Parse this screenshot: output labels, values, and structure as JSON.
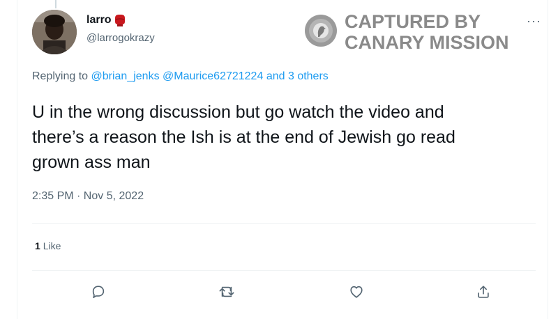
{
  "tweet": {
    "display_name": "larro",
    "handle": "@larrogokrazy",
    "replying_prefix": "Replying to",
    "replying_users": "@brian_jenks @Maurice62721224",
    "replying_connector": "and",
    "replying_others": "3 others",
    "text_lines": [
      "U in the wrong discussion but go watch the video and",
      "there’s a reason the Ish is at the end of Jewish go read",
      "grown ass man"
    ],
    "timestamp": "2:35 PM · Nov 5, 2022",
    "like_count": "1",
    "like_label": "Like",
    "more_label": "···"
  },
  "watermark": {
    "line1": "CAPTURED BY",
    "line2": "CANARY MISSION"
  },
  "icons": {
    "reply": "comment-icon",
    "retweet": "retweet-icon",
    "like": "heart-icon",
    "share": "share-icon",
    "name_emoji": "boxing-glove-icon",
    "watermark_logo": "canary-bird-icon"
  },
  "colors": {
    "link": "#1d9bf0",
    "text": "#0f1419",
    "secondary": "#536471",
    "watermark": "#8a8a8a",
    "divider": "#eff3f4"
  }
}
